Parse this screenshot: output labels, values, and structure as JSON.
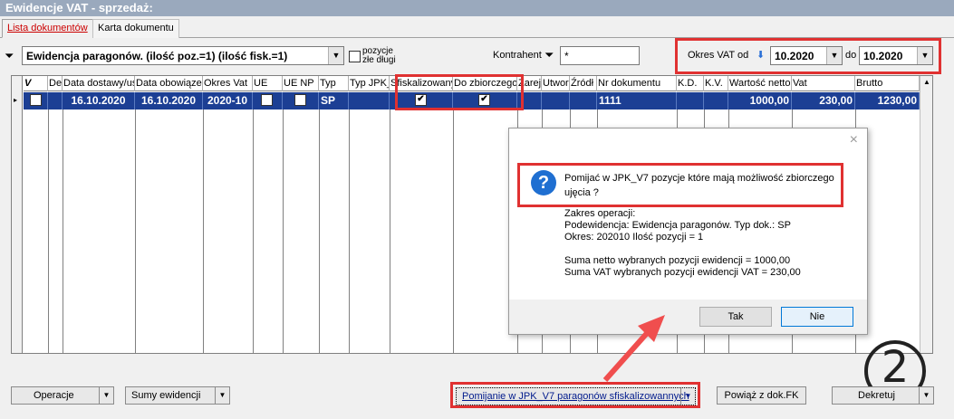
{
  "window": {
    "title": "Ewidencje VAT - sprzedaż:"
  },
  "tabs": [
    {
      "label": "Lista dokumentów"
    },
    {
      "label": "Karta dokumentu"
    }
  ],
  "filter": {
    "combo_value": "Ewidencja paragonów.   (ilość poz.=1)   (ilość fisk.=1)",
    "bad_debts_label_1": "pozycje",
    "bad_debts_label_2": "złe długi",
    "contractor_label": "Kontrahent",
    "contractor_value": "*",
    "vat_period_label": "Okres VAT od",
    "period_from": "10.2020",
    "period_to_label": "do",
    "period_to": "10.2020"
  },
  "grid": {
    "headers": [
      "V",
      "Dek",
      "Data dostawy/us",
      "Data obowiązek",
      "Okres Vat",
      "UE",
      "UE NP",
      "Typ",
      "Typ JPK_",
      "Sfiskalizowany",
      "Do zbiorczego",
      "Zareje",
      "Utwor",
      "Źródł",
      "Nr dokumentu",
      "K.D.",
      "K.V.",
      "Wartość netto",
      "Vat",
      "Brutto"
    ],
    "row": {
      "data_dostawy": "16.10.2020",
      "data_obowiazek": "16.10.2020",
      "okres": "2020-10",
      "typ": "SP",
      "nr_dokumentu": "1111",
      "netto": "1000,00",
      "vat": "230,00",
      "brutto": "1230,00"
    }
  },
  "dialog": {
    "question_line1": "Pomijać w JPK_V7 pozycje które mają możliwość zbiorczego",
    "question_line2": "ujęcia ?",
    "scope_title": "Zakres operacji:",
    "scope_line1": "Podewidencja: Ewidencja paragonów. Typ dok.: SP",
    "scope_line2": "Okres: 202010  Ilość pozycji = 1",
    "sum_netto": "Suma netto wybranych pozycji ewidencji   = 1000,00",
    "sum_vat": "Suma VAT wybranych pozycji ewidencji VAT = 230,00",
    "yes": "Tak",
    "no": "Nie",
    "close": "×"
  },
  "bottom": {
    "operations": "Operacje",
    "sums": "Sumy ewidencji",
    "skip_jpk": "Pomijanie w JPK_V7 paragonów sfiskalizowannych",
    "link_fk": "Powiąż z dok.FK",
    "decree": "Dekretuj"
  },
  "annotation": {
    "step": "2"
  }
}
